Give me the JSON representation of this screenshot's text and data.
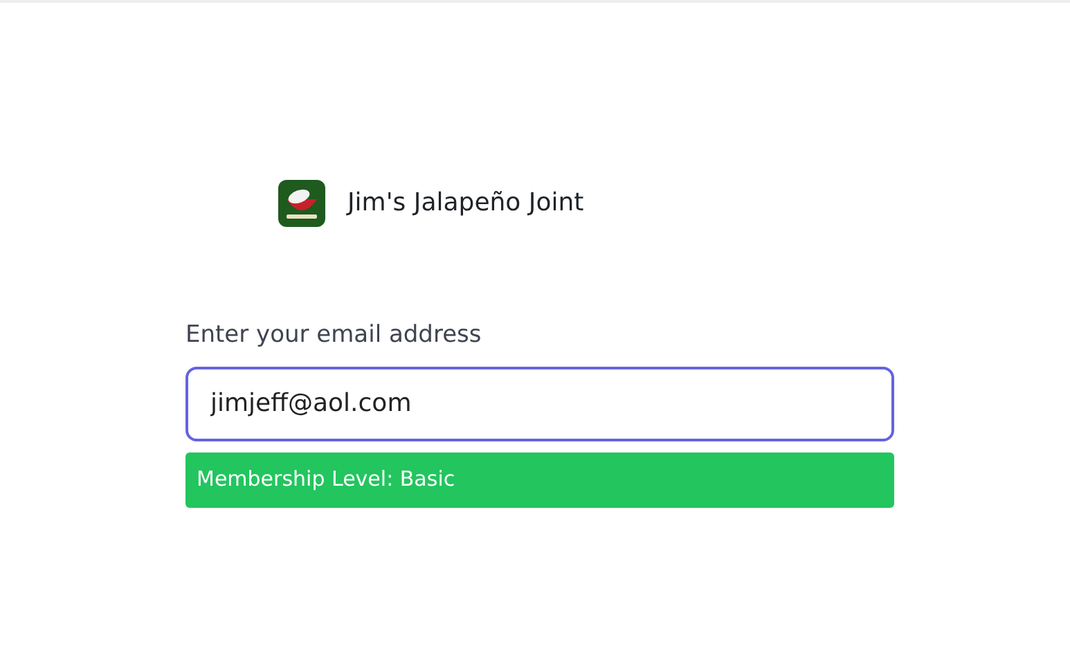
{
  "header": {
    "title": "Jim's Jalapeño Joint"
  },
  "email_field": {
    "label": "Enter your email address",
    "value": "jimjeff@aol.com",
    "focused": true
  },
  "membership_banner": {
    "text": "Membership Level: Basic",
    "color": "#22c55e"
  }
}
